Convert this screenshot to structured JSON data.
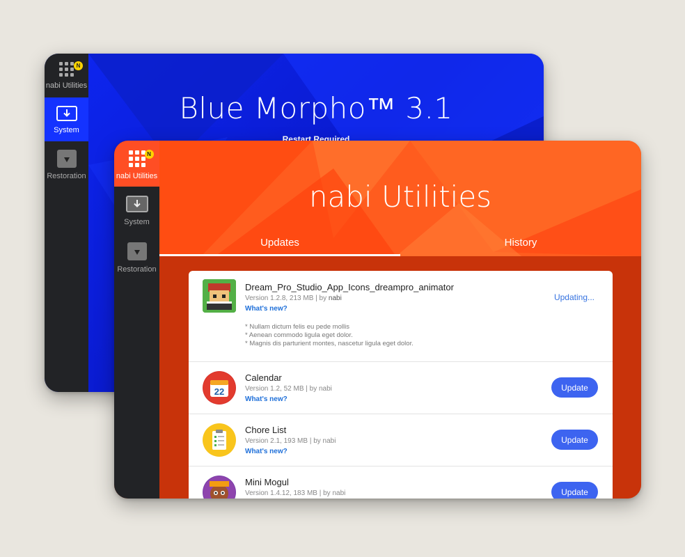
{
  "back_window": {
    "title": "Blue Morpho™  3.1",
    "subtitle": "Restart Required",
    "sidebar": [
      {
        "label": "nabi Utilities",
        "badge": "N",
        "icon": "apps-grid-icon"
      },
      {
        "label": "System",
        "icon": "system-download-icon",
        "active": true
      },
      {
        "label": "Restoration",
        "icon": "restore-box-icon"
      }
    ]
  },
  "front_window": {
    "title": "nabi Utilities",
    "tabs": [
      {
        "label": "Updates",
        "active": true
      },
      {
        "label": "History",
        "active": false
      }
    ],
    "sidebar": [
      {
        "label": "nabi Utilities",
        "badge": "N",
        "icon": "apps-grid-icon",
        "active": true
      },
      {
        "label": "System",
        "icon": "system-download-icon"
      },
      {
        "label": "Restoration",
        "icon": "restore-box-icon"
      }
    ],
    "apps": [
      {
        "name": "Dream_Pro_Studio_App_Icons_dreampro_animator",
        "meta": "Version 1.2.8, 213 MB | by",
        "author": "nabi",
        "whats_new": "What's new?",
        "status": "Updating...",
        "notes": [
          "*  Nullam dictum felis eu pede mollis",
          "*  Aenean commodo ligula eget dolor.",
          "*  Magnis dis parturient montes, nascetur ligula eget dolor."
        ],
        "icon": "animator-character-icon"
      },
      {
        "name": "Calendar",
        "meta": "Version 1.2, 52 MB | by nabi",
        "whats_new": "What's new?",
        "action": "Update",
        "icon_text": "22",
        "icon": "calendar-icon"
      },
      {
        "name": "Chore List",
        "meta": "Version 2.1, 193 MB | by nabi",
        "whats_new": "What's new?",
        "action": "Update",
        "icon": "clipboard-checklist-icon"
      },
      {
        "name": "Mini Mogul",
        "meta": "Version 1.4.12, 183 MB | by nabi",
        "action": "Update",
        "icon": "mini-mogul-character-icon"
      }
    ]
  },
  "colors": {
    "background": "#e9e6df",
    "blue_accent": "#0a22e0",
    "orange_header": "#ff5c1e",
    "orange_dark": "#c8330a",
    "sidebar": "#222326",
    "update_button": "#3d64f0",
    "badge": "#ffd400"
  }
}
